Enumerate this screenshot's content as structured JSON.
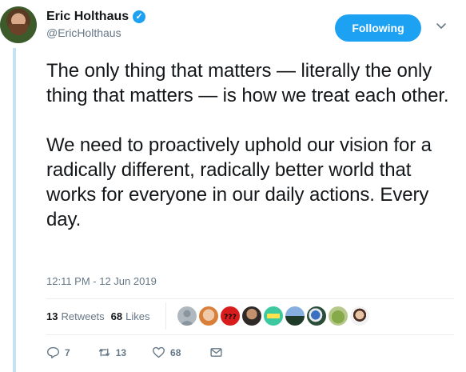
{
  "author": {
    "display_name": "Eric Holthaus",
    "handle": "@EricHolthaus",
    "verified_icon": "verified-badge-icon"
  },
  "follow_button": {
    "label": "Following"
  },
  "tweet": {
    "text": "The only thing that matters — literally the only thing that matters — is how we treat each other.\n\nWe need to proactively uphold our vision for a radically different, radically better world that works for everyone in our daily actions. Every day.",
    "timestamp": "12:11 PM - 12 Jun 2019"
  },
  "stats": {
    "retweets_count": "13",
    "retweets_label": "Retweets",
    "likes_count": "68",
    "likes_label": "Likes"
  },
  "actions": {
    "reply_count": "7",
    "retweet_count": "13",
    "like_count": "68"
  },
  "colors": {
    "accent": "#1da1f2",
    "thread_line": "#c5e3f2",
    "muted_text": "#657786"
  }
}
